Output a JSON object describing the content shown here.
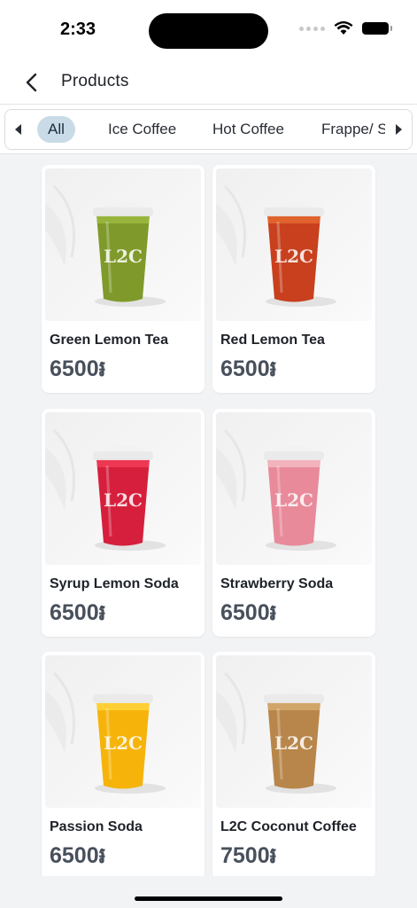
{
  "status_bar": {
    "time": "2:33"
  },
  "header": {
    "title": "Products"
  },
  "categories": {
    "items": [
      {
        "label": "All",
        "active": true
      },
      {
        "label": "Ice Coffee",
        "active": false
      },
      {
        "label": "Hot Coffee",
        "active": false
      },
      {
        "label": "Frappe/ S",
        "active": false
      }
    ]
  },
  "products": [
    {
      "name": "Green Lemon Tea",
      "price": "6500៛",
      "drink_color": "#7f9a2a",
      "rim_color": "#9ab83e",
      "icon": "green-lemon-tea-image"
    },
    {
      "name": "Red Lemon Tea",
      "price": "6500៛",
      "drink_color": "#c8401e",
      "rim_color": "#e2662f",
      "icon": "red-lemon-tea-image"
    },
    {
      "name": "Syrup Lemon Soda",
      "price": "6500៛",
      "drink_color": "#d61f3c",
      "rim_color": "#ef3a55",
      "icon": "syrup-lemon-soda-image"
    },
    {
      "name": "Strawberry Soda",
      "price": "6500៛",
      "drink_color": "#e88a9a",
      "rim_color": "#f3b7c0",
      "icon": "strawberry-soda-image"
    },
    {
      "name": "Passion Soda",
      "price": "6500៛",
      "drink_color": "#f6b40a",
      "rim_color": "#ffd23a",
      "icon": "passion-soda-image"
    },
    {
      "name": "L2C Coconut Coffee",
      "price": "7500៛",
      "drink_color": "#b8864a",
      "rim_color": "#d4a96e",
      "icon": "coconut-coffee-image"
    }
  ],
  "cup_logo": "L2C"
}
